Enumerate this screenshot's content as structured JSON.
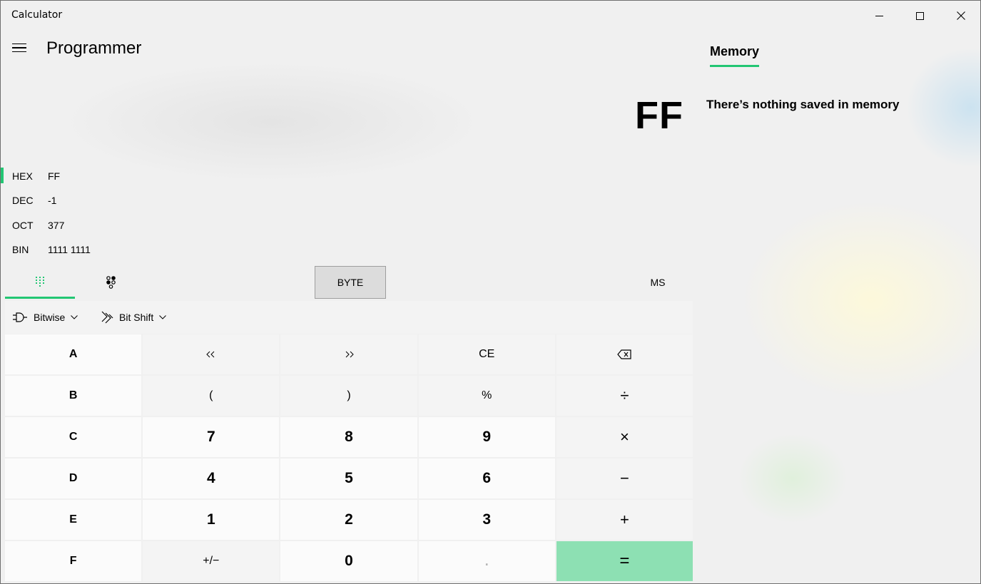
{
  "window": {
    "title": "Calculator",
    "controls": [
      "minimize",
      "maximize",
      "close"
    ]
  },
  "header": {
    "mode_title": "Programmer"
  },
  "display": {
    "value": "FF"
  },
  "radix": [
    {
      "label": "HEX",
      "value": "FF",
      "active": true
    },
    {
      "label": "DEC",
      "value": "-1",
      "active": false
    },
    {
      "label": "OCT",
      "value": "377",
      "active": false
    },
    {
      "label": "BIN",
      "value": "1111 1111",
      "active": false
    }
  ],
  "keypad_tabs": {
    "full_keypad_icon": "keypad-icon",
    "bit_toggle_icon": "bit-toggle-icon",
    "word_size": "BYTE",
    "memory_store": "MS"
  },
  "dropdowns": {
    "bitwise": "Bitwise",
    "bitshift": "Bit Shift"
  },
  "keys": [
    [
      "A",
      "«",
      "»",
      "CE",
      "backspace"
    ],
    [
      "B",
      "(",
      ")",
      "%",
      "÷"
    ],
    [
      "C",
      "7",
      "8",
      "9",
      "×"
    ],
    [
      "D",
      "4",
      "5",
      "6",
      "−"
    ],
    [
      "E",
      "1",
      "2",
      "3",
      "+"
    ],
    [
      "F",
      "+/−",
      "0",
      ".",
      "="
    ]
  ],
  "key_labels": {
    "a": "A",
    "lsh": "<<",
    "rsh": ">>",
    "ce": "CE",
    "b": "B",
    "lparen": "(",
    "rparen": ")",
    "percent": "%",
    "divide": "÷",
    "c": "C",
    "n7": "7",
    "n8": "8",
    "n9": "9",
    "multiply": "×",
    "d": "D",
    "n4": "4",
    "n5": "5",
    "n6": "6",
    "minus": "−",
    "e": "E",
    "n1": "1",
    "n2": "2",
    "n3": "3",
    "plus": "+",
    "f": "F",
    "negate": "+/−",
    "n0": "0",
    "decimal": ".",
    "equals": "="
  },
  "memory": {
    "tab_label": "Memory",
    "empty_message": "There’s nothing saved in memory"
  },
  "colors": {
    "accent": "#22c673",
    "equals_bg": "#8de0b3"
  }
}
